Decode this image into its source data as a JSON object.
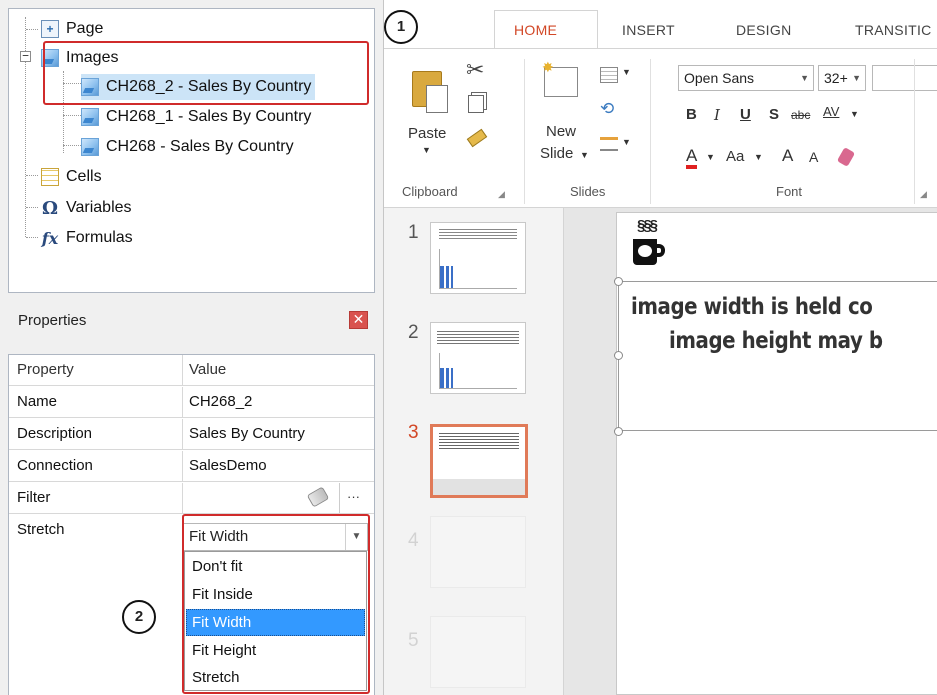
{
  "tree": {
    "items": [
      {
        "label": "Page"
      },
      {
        "label": "Images"
      },
      {
        "label": "CH268_2 - Sales By Country"
      },
      {
        "label": "CH268_1 - Sales By Country"
      },
      {
        "label": "CH268 - Sales By Country"
      },
      {
        "label": "Cells"
      },
      {
        "label": "Variables"
      },
      {
        "label": "Formulas"
      }
    ]
  },
  "properties": {
    "title": "Properties",
    "close_glyph": "✕",
    "col_property": "Property",
    "col_value": "Value",
    "rows": [
      {
        "name": "Name",
        "value": "CH268_2"
      },
      {
        "name": "Description",
        "value": "Sales By Country"
      },
      {
        "name": "Connection",
        "value": "SalesDemo"
      },
      {
        "name": "Filter",
        "value": ""
      },
      {
        "name": "Stretch",
        "value": "Fit Width"
      }
    ],
    "filter_more": "···",
    "stretch_options": [
      "Don't fit",
      "Fit Inside",
      "Fit Width",
      "Fit Height",
      "Stretch"
    ],
    "stretch_selected": "Fit Width"
  },
  "callouts": {
    "one": "1",
    "two": "2"
  },
  "ribbon": {
    "tabs": [
      "HOME",
      "INSERT",
      "DESIGN",
      "TRANSITIC"
    ],
    "active_tab": "HOME",
    "paste_label": "Paste",
    "new_slide_line1": "New",
    "new_slide_line2": "Slide",
    "font_name": "Open Sans",
    "font_size": "32+",
    "bold": "B",
    "italic": "I",
    "underline": "U",
    "shadow": "S",
    "strike": "abc",
    "spacing": "AV",
    "font_color": "A",
    "change_case": "Aa",
    "grow_font": "A",
    "shrink_font": "A",
    "groups": {
      "clipboard": "Clipboard",
      "slides": "Slides",
      "font": "Font"
    },
    "accent_color": "#d24726"
  },
  "slides": {
    "numbers": [
      "1",
      "2",
      "3",
      "4",
      "5"
    ],
    "active": "3"
  },
  "slide": {
    "steam": "§§§",
    "line1": "image width is held co",
    "line2": "image height may b"
  }
}
